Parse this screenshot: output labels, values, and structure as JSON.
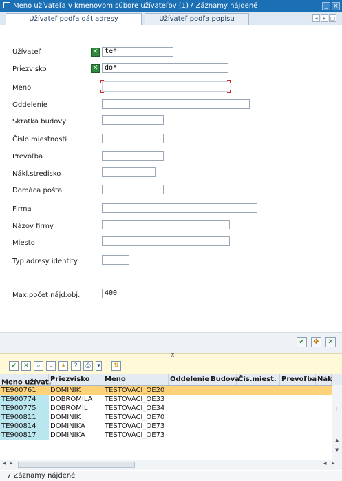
{
  "window": {
    "title": "Meno užívateľa v kmenovom súbore užívateľov (1)",
    "count_text": "7 Záznamy nájdené",
    "minimize_glyph": "_",
    "close_glyph": "×"
  },
  "tabs": [
    {
      "label": "Užívateľ podľa dát adresy",
      "active": true
    },
    {
      "label": "Užívateľ podľa popisu",
      "active": false
    }
  ],
  "tab_nav": [
    "◂",
    "▸",
    "▢"
  ],
  "form": {
    "fields": [
      {
        "label": "Užívateľ",
        "value": "te*",
        "has_select_icon": true
      },
      {
        "label": "Priezvisko",
        "value": "do*",
        "has_select_icon": true
      },
      {
        "label": "Meno",
        "value": "",
        "focused": true
      },
      {
        "label": "Oddelenie",
        "value": ""
      },
      {
        "label": "Skratka budovy",
        "value": ""
      },
      {
        "label": "Číslo miestnosti",
        "value": ""
      },
      {
        "label": "Prevoľba",
        "value": ""
      },
      {
        "label": "Nákl.stredisko",
        "value": ""
      },
      {
        "label": "Domáca pošta",
        "value": ""
      },
      {
        "label": "Firma",
        "value": ""
      },
      {
        "label": "Názov firmy",
        "value": ""
      },
      {
        "label": "Miesto",
        "value": ""
      },
      {
        "label": "Typ adresy identity",
        "value": ""
      }
    ],
    "max_label": "Max.počet nájd.obj.",
    "max_value": "400"
  },
  "action_buttons": [
    {
      "name": "confirm-icon",
      "glyph": "✔",
      "color": "#2f8f2f"
    },
    {
      "name": "search-settings-icon",
      "glyph": "✥",
      "color": "#c77a14"
    },
    {
      "name": "cancel-icon",
      "glyph": "✕",
      "color": "#2e7a3a"
    }
  ],
  "divider_glyph": "⊼",
  "toolbar_icons": [
    {
      "name": "check-icon",
      "glyph": "✔"
    },
    {
      "name": "filter-x-icon",
      "glyph": "✕"
    },
    {
      "name": "find-icon",
      "glyph": "⌕"
    },
    {
      "name": "find-next-icon",
      "glyph": "⌕"
    },
    {
      "name": "favorites-icon",
      "glyph": "★"
    },
    {
      "name": "help-search-icon",
      "glyph": "?"
    },
    {
      "name": "print-icon",
      "glyph": "⎙"
    },
    {
      "name": "print-menu-icon",
      "glyph": "▾"
    },
    {
      "name": "sort-icon",
      "glyph": "⇅"
    }
  ],
  "table": {
    "columns": [
      "Meno užívat.",
      "Priezvisko",
      "Meno",
      "Oddelenie",
      "Budova",
      "Čís.miest.",
      "Prevoľba",
      "Nák"
    ],
    "sort_marker": "^",
    "rows": [
      [
        "TE900761",
        "DOMINIK",
        "TESTOVACI_OE20",
        "",
        "",
        "",
        "",
        ""
      ],
      [
        "TE900774",
        "DOBROMILA",
        "TESTOVACI_OE33",
        "",
        "",
        "",
        "",
        ""
      ],
      [
        "TE900775",
        "DOBROMIL",
        "TESTOVACI_OE34",
        "",
        "",
        "",
        "",
        ""
      ],
      [
        "TE900811",
        "DOMINIK",
        "TESTOVACI_OE70",
        "",
        "",
        "",
        "",
        ""
      ],
      [
        "TE900814",
        "DOMINIKA",
        "TESTOVACI_OE73",
        "",
        "",
        "",
        "",
        ""
      ],
      [
        "TE900817",
        "DOMINIKA",
        "TESTOVACI_OE73",
        "",
        "",
        "",
        "",
        ""
      ]
    ],
    "selected_row": 0,
    "colors": {
      "selected": "#ffd27a",
      "key_cell": "#b9e6ef",
      "row": "#ffffff"
    }
  },
  "scroll_glyphs": {
    "up": "▲",
    "down": "▼",
    "left": "◂",
    "right": "▸",
    "grip": "⁝"
  },
  "status_text": "7 Záznamy nájdené"
}
